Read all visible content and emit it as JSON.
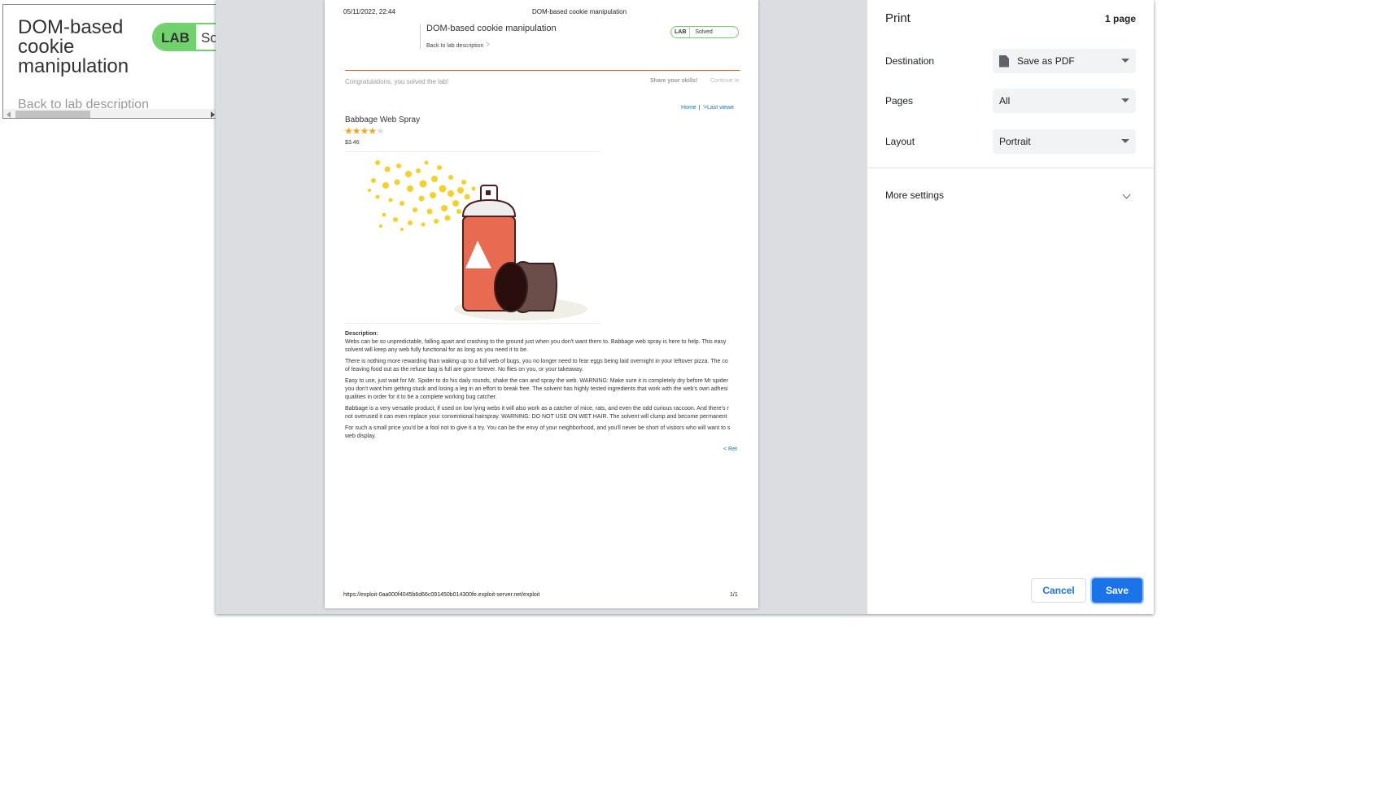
{
  "background_page": {
    "title": "DOM-based cookie manipulation",
    "badge_lab": "LAB",
    "badge_status": "Solv",
    "back_link": "Back to lab description"
  },
  "preview": {
    "date": "05/11/2022, 22:44",
    "header_title": "DOM-based cookie manipulation",
    "lab_title": "DOM-based cookie manipulation",
    "back_link": "Back to lab description",
    "back_icon": "chevron-icon",
    "badge_lab": "LAB",
    "badge_status": "Solved",
    "congrats": "Congratulations, you solved the lab!",
    "share": "Share your skills!",
    "continue": "Continue le",
    "nav_home": "Home",
    "nav_sep": "|",
    "nav_last": "'>Last viewe",
    "product_name": "Babbage Web Spray",
    "rating": 4,
    "rating_max": 5,
    "price": "$3.46",
    "description_label": "Description:",
    "paragraphs": [
      "Webs can be so unpredictable, falling apart and crashing to the ground just when you don't want them to. Babbage web spray is here to help. This easy",
      "solvent will keep any web fully functional for as long as you need it to be.",
      "There is nothing more rewarding than waking up to a full web of bugs, you no longer need to fear eggs being laid overnight in your leftover pizza. The co",
      "of leaving food out as the refuse bag is full are gone forever. No flies on you, or your takeaway.",
      "Easy to use, just wait for Mr. Spider to do his daily rounds, shake the can and spray the web. WARNING: Make sure it is completely dry before Mr spider",
      "you don't want him getting stuck and losing a leg in an effort to break free. The solvent has highly tested ingredients that work with the web's own adhesi",
      "qualities in order for it to be a complete working bug catcher.",
      "Babbage is a very versatile product, if used on low lying webs it will also work as a catcher of mice, rats, and even the odd curious raccoon. And there's r",
      "not overused it can even replace your conventional hairspray. WARNING: DO NOT USE ON WET HAIR. The solvent will clump and become permanent",
      "For such a small price you'd be a fool not to give it a try. You can be the envy of your neighborhood, and you'll never be short of visitors who will want to s",
      "web display."
    ],
    "return_link": "< Ret",
    "footer_url": "https://exploit-0aa000f4045b6d66c091450b014300fe.exploit-server.net/exploit",
    "footer_page": "1/1"
  },
  "settings": {
    "title": "Print",
    "page_count": "1 page",
    "destination_label": "Destination",
    "destination_value": "Save as PDF",
    "pages_label": "Pages",
    "pages_value": "All",
    "layout_label": "Layout",
    "layout_value": "Portrait",
    "more_settings": "More settings",
    "cancel": "Cancel",
    "save": "Save"
  },
  "colors": {
    "accent": "#1a73e8",
    "lab_green": "#70d16d",
    "divider_orange": "#e0542a",
    "star": "#f5a623"
  }
}
